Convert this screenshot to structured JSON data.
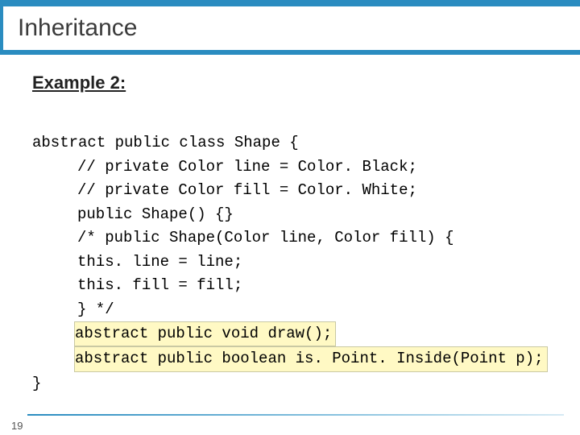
{
  "title": "Inheritance",
  "heading": "Example 2:",
  "code": {
    "l1": "abstract public class Shape {",
    "l2": "// private Color line = Color. Black;",
    "l3": "// private Color fill = Color. White;",
    "l4": "public Shape() {}",
    "l5": "/* public Shape(Color line, Color fill) {",
    "l6": "this. line = line;",
    "l7": "this. fill = fill;",
    "l8": "} */",
    "h1": "abstract public void draw();",
    "h2": "abstract public boolean is. Point. Inside(Point p);",
    "l9": "}"
  },
  "page": "19"
}
